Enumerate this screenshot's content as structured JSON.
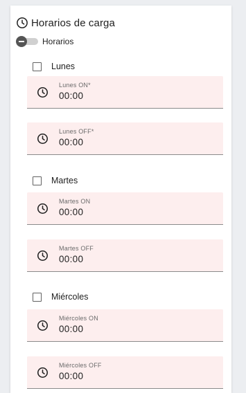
{
  "header": {
    "title": "Horarios de carga",
    "icon": "clock-icon"
  },
  "toggle": {
    "label": "Horarios",
    "state": "off"
  },
  "days": [
    {
      "label": "Lunes",
      "checked": false,
      "on_label": "Lunes ON*",
      "on_value": "00:00",
      "off_label": "Lunes OFF*",
      "off_value": "00:00"
    },
    {
      "label": "Martes",
      "checked": false,
      "on_label": "Martes ON",
      "on_value": "00:00",
      "off_label": "Martes OFF",
      "off_value": "00:00"
    },
    {
      "label": "Miércoles",
      "checked": false,
      "on_label": "Miércoles ON",
      "on_value": "00:00",
      "off_label": "Miércoles OFF",
      "off_value": "00:00"
    }
  ],
  "colors": {
    "field_background": "#fdeeee",
    "text": "#212121",
    "label": "#6a6a6a",
    "toggle_thumb": "#555555"
  }
}
